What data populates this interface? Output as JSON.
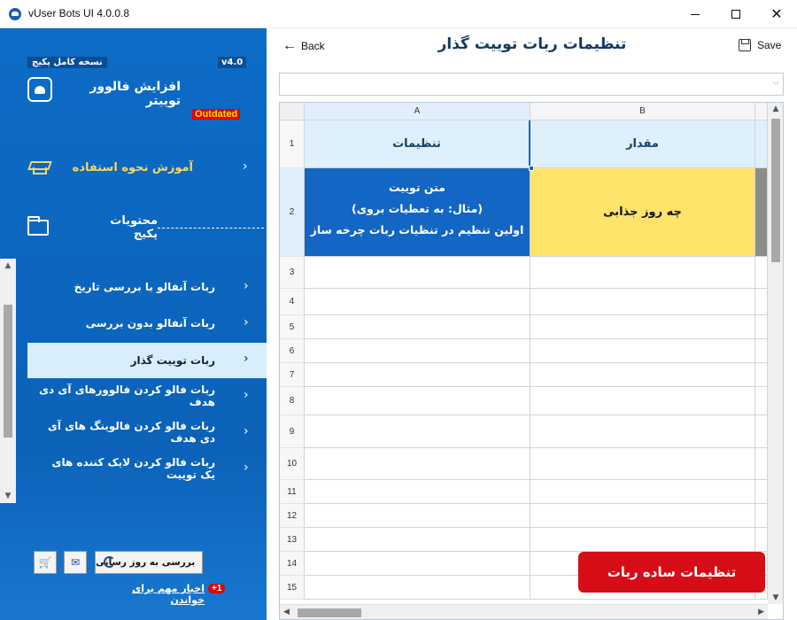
{
  "window": {
    "title": "vUser Bots UI 4.0.0.8"
  },
  "sidebar": {
    "edition": "نسخه کامل پکیج",
    "version": "v4.0",
    "app_name": "افزایش فالوور توییتر",
    "status": "Outdated",
    "tutorial_label": "آموزش نحوه استفاده",
    "package_label": "محتویات پکیج",
    "items": [
      {
        "label": "ربات آنفالو با بررسی تاریخ"
      },
      {
        "label": "ربات آنفالو بدون بررسی"
      },
      {
        "label": "ربات توییت گذار"
      },
      {
        "label": "ربات فالو کردن فالوورهای آی دی هدف"
      },
      {
        "label": "ربات فالو کردن فالوینگ های آی دی هدف"
      },
      {
        "label": "ربات فالو کردن لایک کننده های یک توییت"
      }
    ],
    "active_index": 2,
    "update_button": "بررسی به روز رسانی",
    "news_link": "اخبار مهم برای خواندن",
    "news_badge": "+1"
  },
  "header": {
    "back_label": "Back",
    "title": "تنظیمات ربات توییت گذار",
    "save_label": "Save"
  },
  "grid": {
    "columns": [
      "A",
      "B"
    ],
    "header_row": {
      "row_number": "1",
      "col_a": "تنظیمات",
      "col_b": "مقدار"
    },
    "data_row": {
      "row_number": "2",
      "col_a_lines": [
        "متن توییت",
        "(مثال: به تعطیات بروی)",
        "اولین تنظیم در تنظیات ربات چرخه ساز"
      ],
      "col_b": "چه روز جذابی"
    },
    "empty_rows": [
      "3",
      "4",
      "5",
      "6",
      "7",
      "8",
      "9",
      "10",
      "11",
      "12",
      "13",
      "14",
      "15"
    ]
  },
  "simple_settings_button": "تنظیمات ساده ربات",
  "colors": {
    "sidebar_bg": "#0b62b8",
    "active_item_bg": "#d9eefb",
    "header_cell_bg": "#ddf0fb",
    "settings_cell_bg": "#1366c3",
    "value_cell_bg": "#ffe36b",
    "primary_button": "#d60d17",
    "outdated_bg": "#e30000",
    "outdated_text": "#ffe000"
  }
}
